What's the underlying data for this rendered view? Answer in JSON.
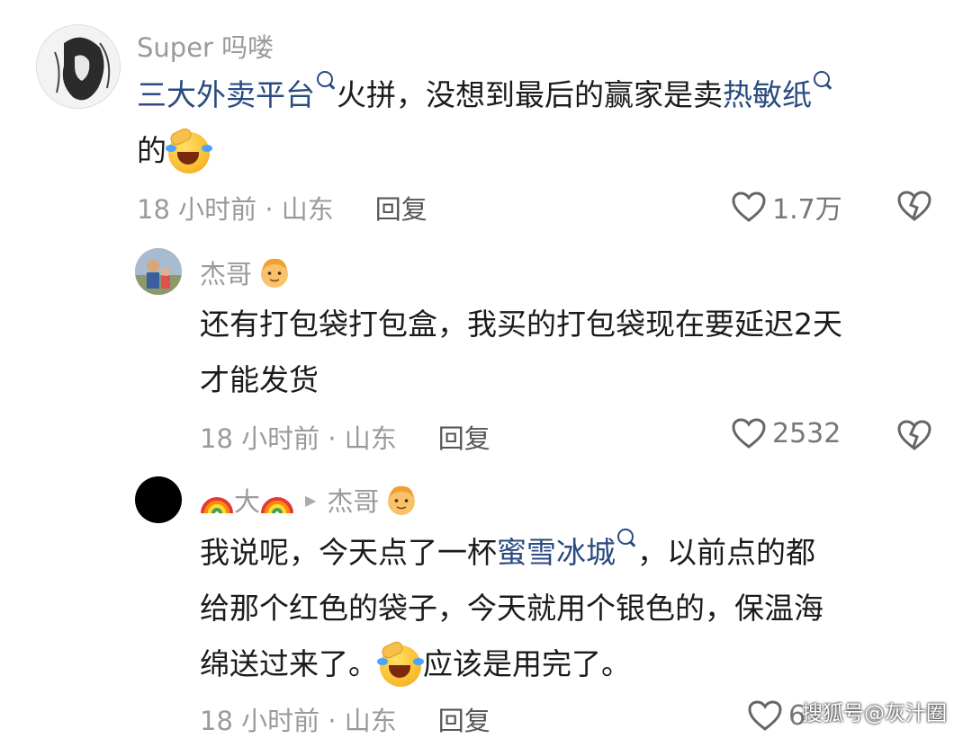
{
  "comments": [
    {
      "username": "Super 吗喽",
      "text_parts": {
        "link1": "三大外卖平台",
        "mid": "火拼，没想到最后的赢家是卖",
        "link2": "热敏纸",
        "end": "的"
      },
      "meta": "18 小时前 · 山东",
      "reply_label": "回复",
      "likes": "1.7万"
    },
    {
      "username": "杰哥",
      "text_line1": "还有打包袋打包盒，我买的打包袋现在要延迟2天",
      "text_line2": "才能发货",
      "meta": "18 小时前 · 山东",
      "reply_label": "回复",
      "likes": "2532"
    },
    {
      "username_main": "大",
      "reply_to": "杰哥",
      "text_parts": {
        "start": "我说呢，今天点了一杯",
        "link": "蜜雪冰城",
        "rest1": "，以前点的都",
        "line2": "给那个红色的袋子，今天就用个银色的，保温海",
        "line3a": "绵送过来了。",
        "line3b": "应该是用完了。"
      },
      "meta": "18 小时前 · 山东",
      "reply_label": "回复",
      "likes": "6"
    }
  ],
  "watermark": "搜狐号@灰汁圈",
  "icons": [
    "search-icon",
    "laughing-emoji-icon",
    "heart-icon",
    "broken-heart-icon",
    "man-emoji-icon",
    "rainbow-emoji-icon",
    "reply-arrow-icon"
  ],
  "colors": {
    "link": "#2a4b80",
    "meta": "#9a9a9a",
    "text": "#1b1b1b"
  }
}
